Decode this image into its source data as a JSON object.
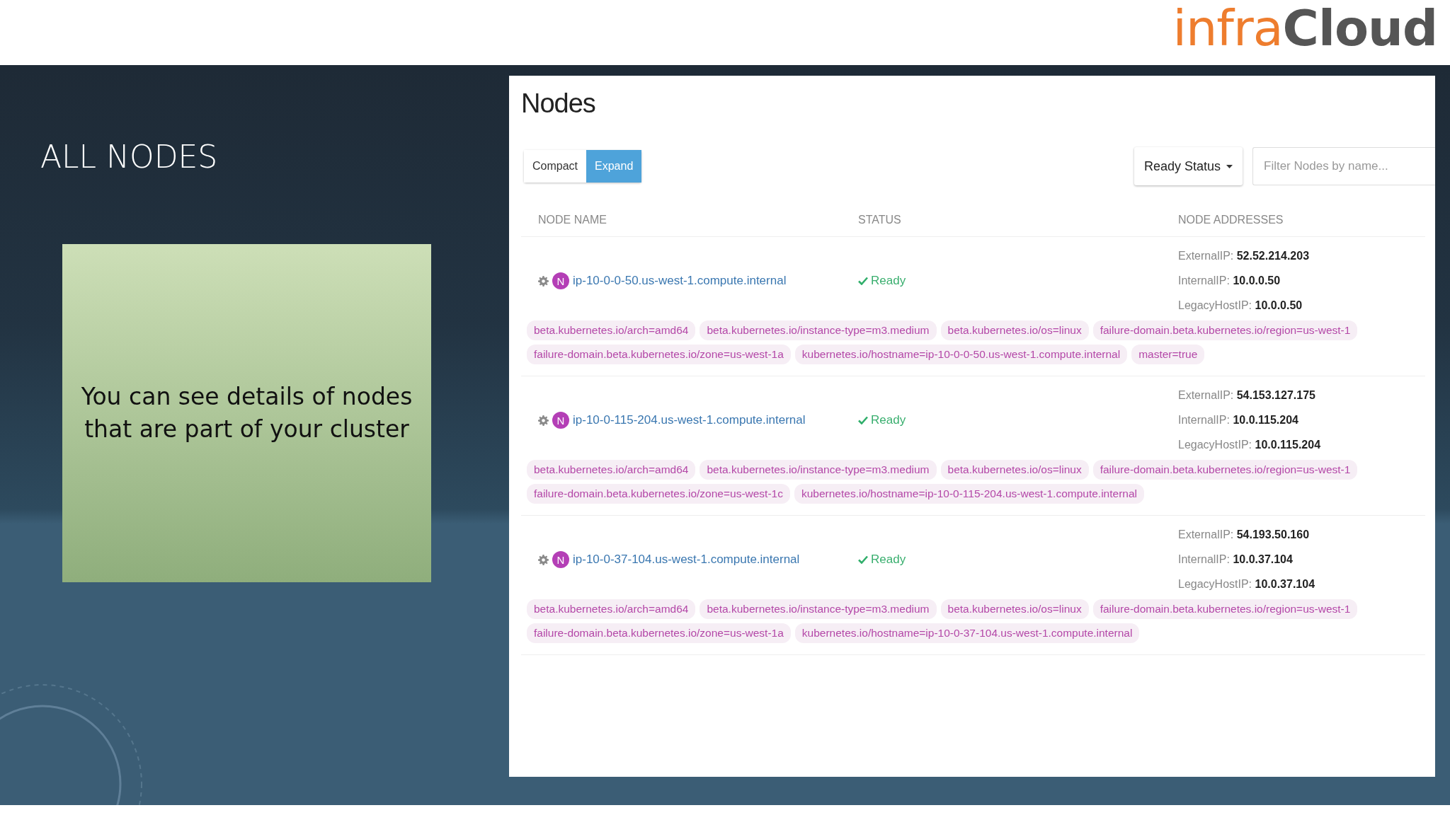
{
  "logo": {
    "first": "infra",
    "second": "Cloud"
  },
  "slide": {
    "title": "ALL NODES",
    "note": "You can see details of nodes that are part of your cluster"
  },
  "panel": {
    "title": "Nodes",
    "view_toggle": [
      {
        "label": "Compact",
        "selected": false
      },
      {
        "label": "Expand",
        "selected": true
      }
    ],
    "status_dropdown": {
      "label": "Ready Status"
    },
    "filter": {
      "placeholder": "Filter Nodes by name..."
    },
    "columns": [
      "NODE NAME",
      "STATUS",
      "NODE ADDRESSES"
    ],
    "nodes": [
      {
        "badge": "N",
        "name": "ip-10-0-0-50.us-west-1.compute.internal",
        "status": "Ready",
        "ready": true,
        "addresses": [
          {
            "label": "ExternalIP:",
            "value": "52.52.214.203"
          },
          {
            "label": "InternalIP:",
            "value": "10.0.0.50"
          },
          {
            "label": "LegacyHostIP:",
            "value": "10.0.0.50"
          }
        ],
        "labels": [
          "beta.kubernetes.io/arch=amd64",
          "beta.kubernetes.io/instance-type=m3.medium",
          "beta.kubernetes.io/os=linux",
          "failure-domain.beta.kubernetes.io/region=us-west-1",
          "failure-domain.beta.kubernetes.io/zone=us-west-1a",
          "kubernetes.io/hostname=ip-10-0-0-50.us-west-1.compute.internal",
          "master=true"
        ]
      },
      {
        "badge": "N",
        "name": "ip-10-0-115-204.us-west-1.compute.internal",
        "status": "Ready",
        "ready": true,
        "addresses": [
          {
            "label": "ExternalIP:",
            "value": "54.153.127.175"
          },
          {
            "label": "InternalIP:",
            "value": "10.0.115.204"
          },
          {
            "label": "LegacyHostIP:",
            "value": "10.0.115.204"
          }
        ],
        "labels": [
          "beta.kubernetes.io/arch=amd64",
          "beta.kubernetes.io/instance-type=m3.medium",
          "beta.kubernetes.io/os=linux",
          "failure-domain.beta.kubernetes.io/region=us-west-1",
          "failure-domain.beta.kubernetes.io/zone=us-west-1c",
          "kubernetes.io/hostname=ip-10-0-115-204.us-west-1.compute.internal"
        ]
      },
      {
        "badge": "N",
        "name": "ip-10-0-37-104.us-west-1.compute.internal",
        "status": "Ready",
        "ready": true,
        "addresses": [
          {
            "label": "ExternalIP:",
            "value": "54.193.50.160"
          },
          {
            "label": "InternalIP:",
            "value": "10.0.37.104"
          },
          {
            "label": "LegacyHostIP:",
            "value": "10.0.37.104"
          }
        ],
        "labels": [
          "beta.kubernetes.io/arch=amd64",
          "beta.kubernetes.io/instance-type=m3.medium",
          "beta.kubernetes.io/os=linux",
          "failure-domain.beta.kubernetes.io/region=us-west-1",
          "failure-domain.beta.kubernetes.io/zone=us-west-1a",
          "kubernetes.io/hostname=ip-10-0-37-104.us-west-1.compute.internal"
        ]
      }
    ]
  }
}
